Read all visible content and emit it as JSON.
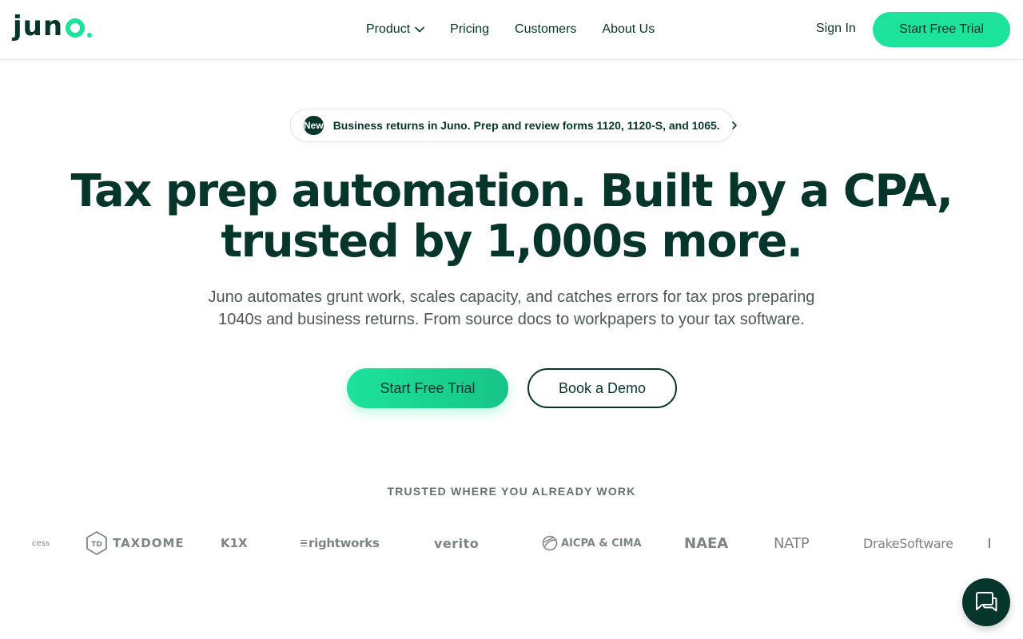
{
  "header": {
    "logo_text": "jun",
    "nav": [
      {
        "label": "Product",
        "has_dropdown": true
      },
      {
        "label": "Pricing"
      },
      {
        "label": "Customers"
      },
      {
        "label": "About Us"
      }
    ],
    "sign_in": "Sign In",
    "cta": "Start Free Trial"
  },
  "announcement": {
    "badge": "New",
    "text": "Business returns in Juno. Prep and review forms 1120, 1120-S, and 1065."
  },
  "hero": {
    "title_line1": "Tax prep automation. Built by a CPA,",
    "title_line2": "trusted by 1,000s more.",
    "subtitle_line1": "Juno automates grunt work, scales capacity, and catches errors for tax pros preparing",
    "subtitle_line2": "1040s and business returns. From source docs to workpapers to your tax software.",
    "primary_cta": "Start Free Trial",
    "secondary_cta": "Book a Demo"
  },
  "trusted": {
    "heading": "TRUSTED WHERE YOU ALREADY WORK",
    "logos": [
      "cess",
      "TAXDOME",
      "K1X",
      "rightworks",
      "verito",
      "AICPA & CIMA",
      "NAEA",
      "NATP",
      "DrakeSoftware"
    ]
  },
  "colors": {
    "brand_dark": "#05352b",
    "brand_green": "#1de39a",
    "muted_text": "#4a5a56",
    "logo_gray": "#7d8584"
  },
  "icons": {
    "chat": "chat-bubble-icon",
    "dropdown": "chevron-down-icon",
    "announcement_arrow": "chevron-right-icon"
  }
}
